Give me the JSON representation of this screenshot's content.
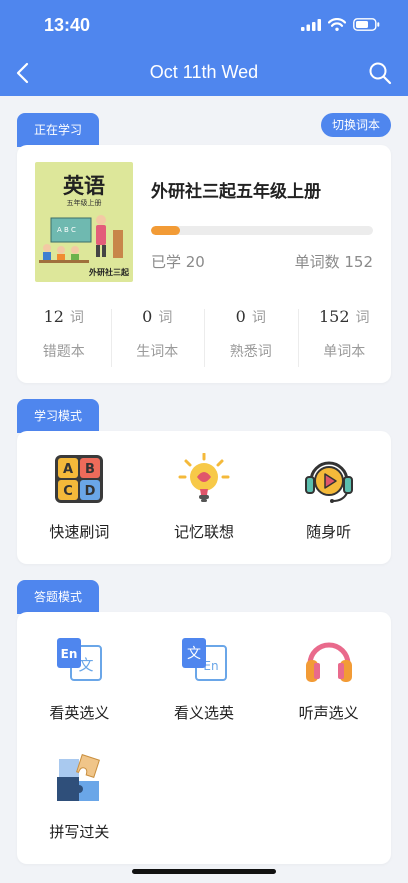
{
  "status_bar": {
    "time": "13:40"
  },
  "nav": {
    "title": "Oct 11th Wed"
  },
  "current": {
    "tab_label": "正在学习",
    "switch_label": "切换词本",
    "book": {
      "cover_title": "英语",
      "cover_subtitle": "五年级上册",
      "cover_publisher": "外研社三起",
      "name": "外研社三起五年级上册",
      "progress": 0.132,
      "learned_label": "已学 20",
      "wordcount_label": "单词数 152"
    },
    "stats": [
      {
        "num": "12",
        "unit": "词",
        "label": "错题本"
      },
      {
        "num": "0",
        "unit": "词",
        "label": "生词本"
      },
      {
        "num": "0",
        "unit": "词",
        "label": "熟悉词"
      },
      {
        "num": "152",
        "unit": "词",
        "label": "单词本"
      }
    ]
  },
  "study": {
    "tab_label": "学习模式",
    "modes": [
      {
        "label": "快速刷词",
        "icon": "abcd-blocks-icon"
      },
      {
        "label": "记忆联想",
        "icon": "lightbulb-icon"
      },
      {
        "label": "随身听",
        "icon": "headset-icon"
      }
    ]
  },
  "quiz": {
    "tab_label": "答题模式",
    "modes": [
      {
        "label": "看英选义",
        "icon": "en-to-zh-icon"
      },
      {
        "label": "看义选英",
        "icon": "zh-to-en-icon"
      },
      {
        "label": "听声选义",
        "icon": "headphones-icon"
      },
      {
        "label": "拼写过关",
        "icon": "puzzle-icon"
      }
    ]
  },
  "colors": {
    "primary": "#4f86ee",
    "progress": "#f29b36",
    "cover": "#dde79a"
  }
}
